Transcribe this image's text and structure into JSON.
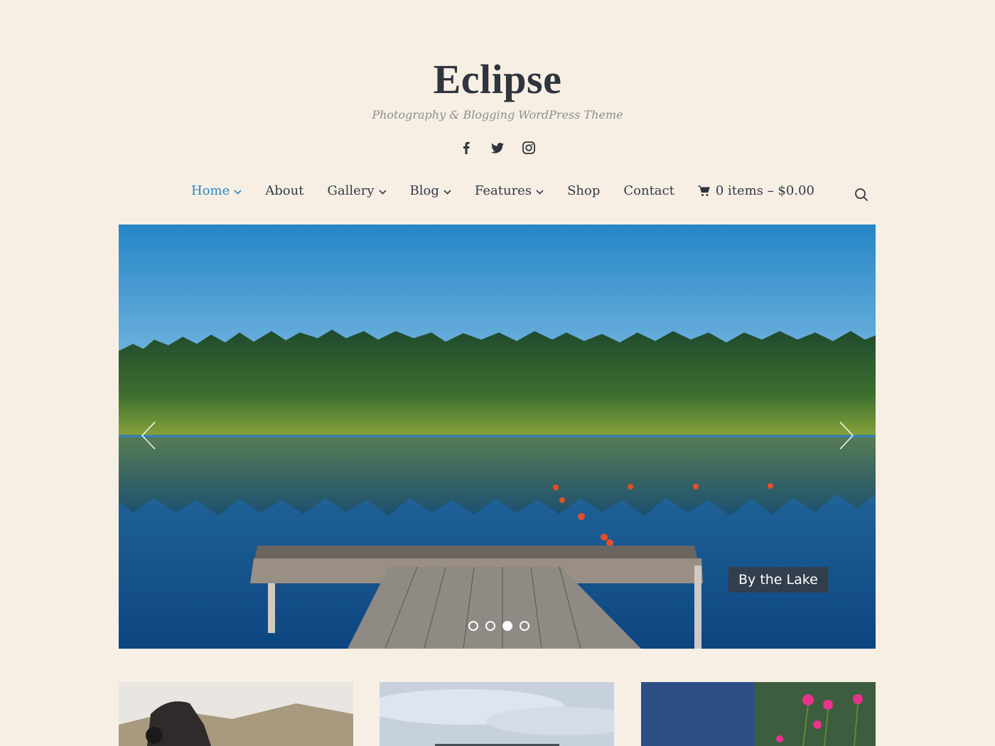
{
  "site": {
    "title": "Eclipse",
    "tagline": "Photography & Blogging WordPress Theme"
  },
  "social_icons": [
    "facebook-icon",
    "twitter-icon",
    "instagram-icon"
  ],
  "nav": {
    "items": [
      {
        "label": "Home",
        "dropdown": true,
        "active": true
      },
      {
        "label": "About",
        "dropdown": false
      },
      {
        "label": "Gallery",
        "dropdown": true
      },
      {
        "label": "Blog",
        "dropdown": true
      },
      {
        "label": "Features",
        "dropdown": true
      },
      {
        "label": "Shop",
        "dropdown": false
      },
      {
        "label": "Contact",
        "dropdown": false
      }
    ],
    "cart_label": "0 items – $0.00"
  },
  "slider": {
    "caption": "By the Lake",
    "slide_count": 4,
    "active_slide": 3
  },
  "colors": {
    "background": "#f7efe4",
    "accent": "#2b86c5",
    "text": "#333b45",
    "caption_bg": "#343d46"
  }
}
